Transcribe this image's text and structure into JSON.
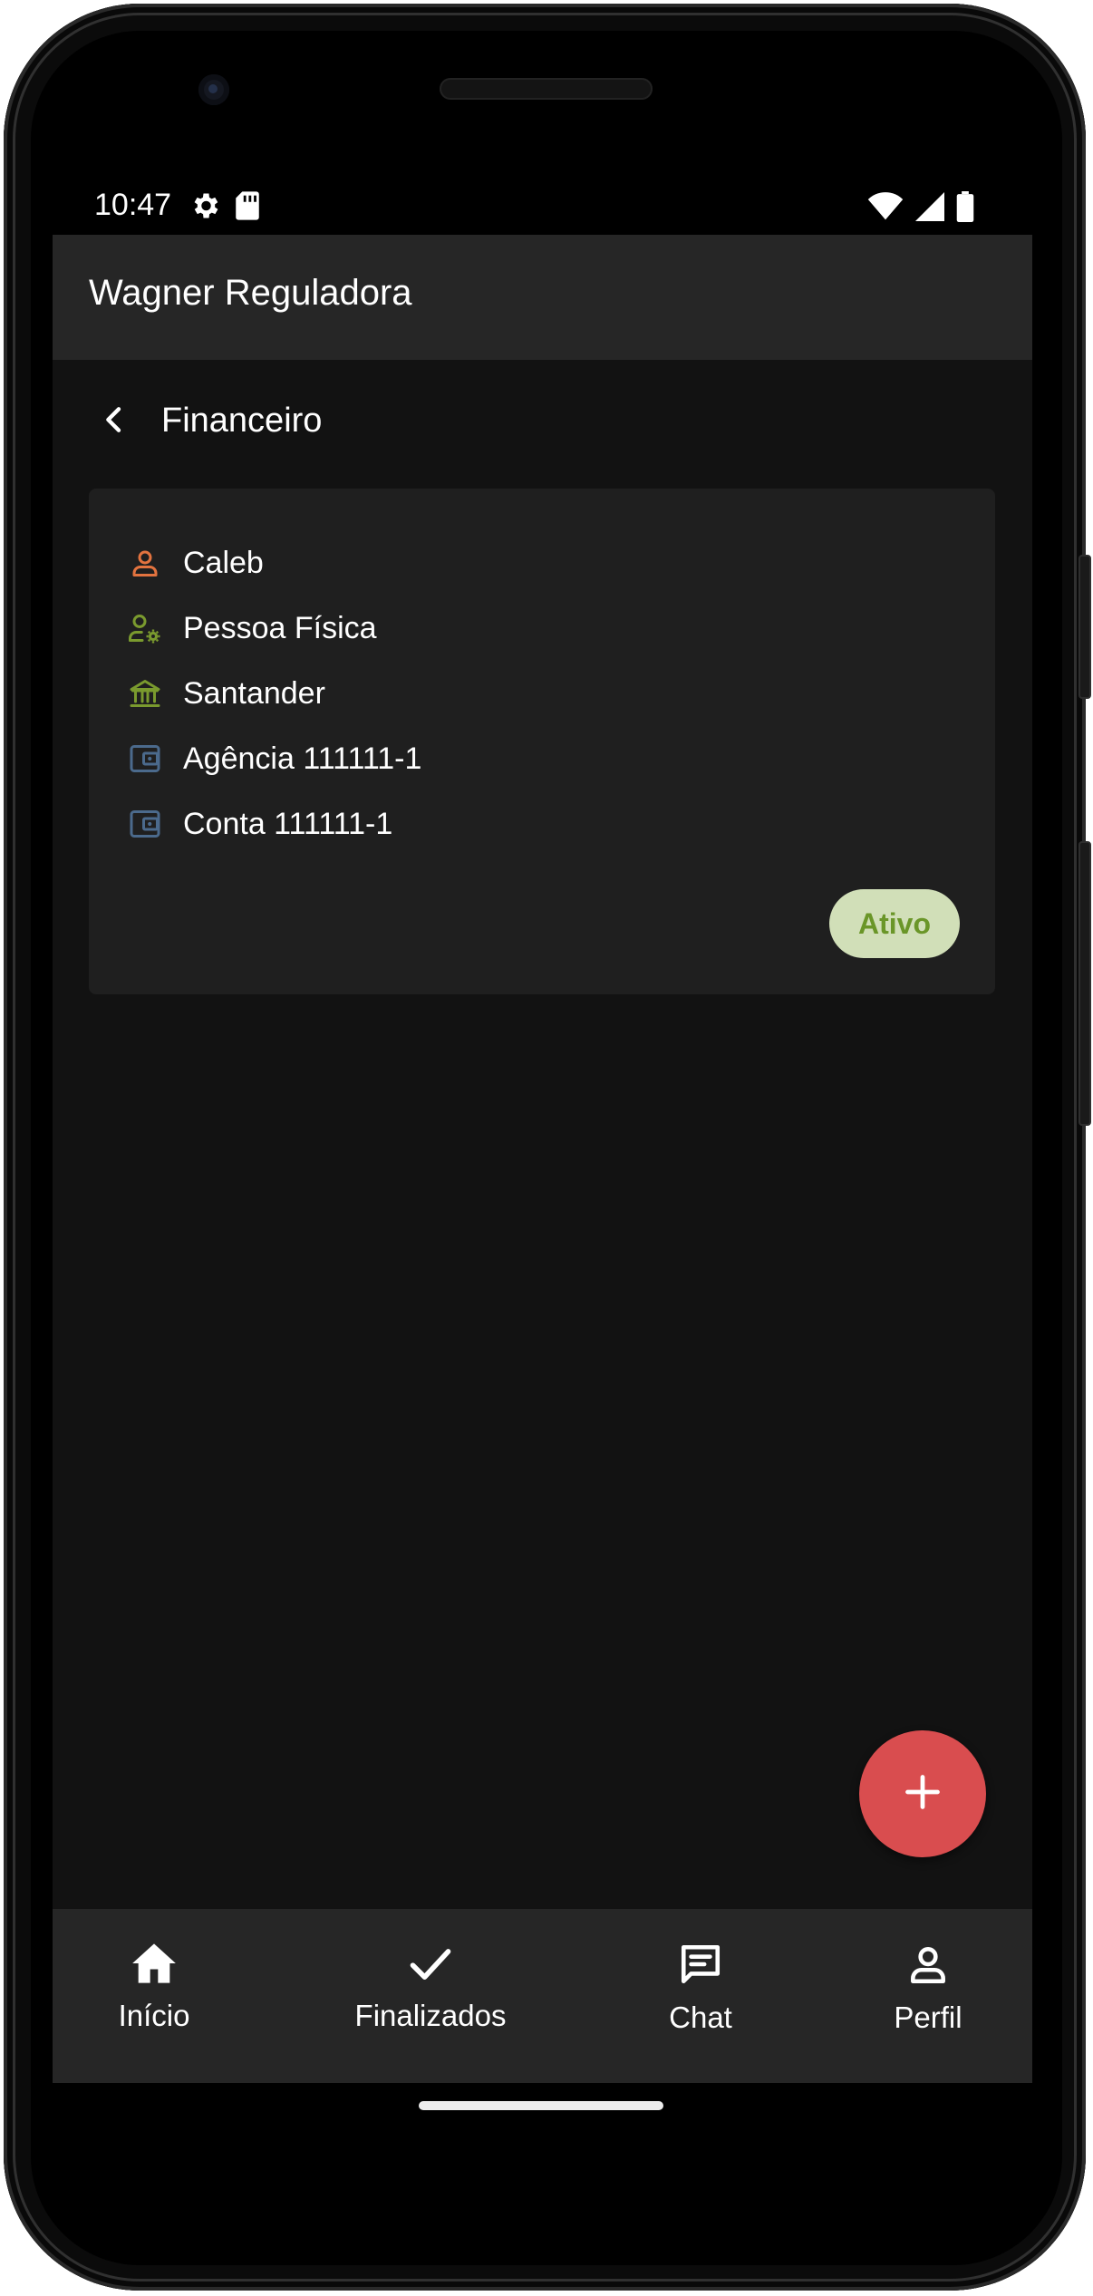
{
  "status_bar": {
    "time": "10:47",
    "icons": [
      "settings-icon",
      "sd-card-icon",
      "wifi-icon",
      "cell-signal-icon",
      "battery-icon"
    ]
  },
  "app_bar": {
    "title": "Wagner Reguladora"
  },
  "page": {
    "back_icon": "chevron-left-icon",
    "title": "Financeiro"
  },
  "account_card": {
    "rows": [
      {
        "icon": "person-icon",
        "icon_color": "#e3733f",
        "label": "Caleb"
      },
      {
        "icon": "person-gear-icon",
        "icon_color": "#7a9a2e",
        "label": "Pessoa Física"
      },
      {
        "icon": "bank-icon",
        "icon_color": "#7a9a2e",
        "label": "Santander"
      },
      {
        "icon": "wallet-icon",
        "icon_color": "#4b6a8c",
        "label": "Agência 111111-1"
      },
      {
        "icon": "wallet-icon",
        "icon_color": "#4b6a8c",
        "label": "Conta 111111-1"
      }
    ],
    "status_badge": "Ativo"
  },
  "fab": {
    "icon": "plus-icon",
    "color": "#d94d4f"
  },
  "bottom_nav": {
    "items": [
      {
        "icon": "home-icon",
        "label": "Início"
      },
      {
        "icon": "check-icon",
        "label": "Finalizados"
      },
      {
        "icon": "chat-icon",
        "label": "Chat"
      },
      {
        "icon": "person-icon",
        "label": "Perfil"
      }
    ]
  },
  "colors": {
    "background": "#121212",
    "app_bar": "#262626",
    "card": "#1f1f1f",
    "badge_bg": "#d1dfb8",
    "badge_text": "#6a9628"
  }
}
